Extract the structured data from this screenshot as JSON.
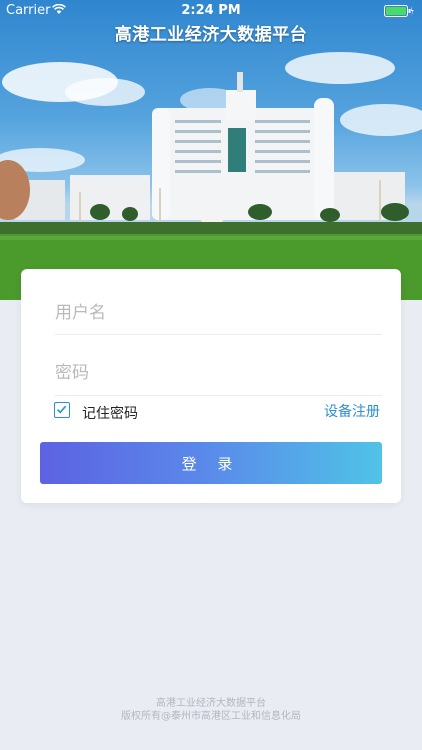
{
  "status_bar": {
    "carrier": "Carrier",
    "time": "2:24 PM",
    "wifi_icon": "wifi-icon",
    "battery_icon": "battery-icon"
  },
  "header": {
    "title": "高港工业经济大数据平台"
  },
  "login_form": {
    "username": {
      "placeholder": "用户名",
      "value": ""
    },
    "password": {
      "placeholder": "密码",
      "value": ""
    },
    "remember": {
      "label": "记住密码",
      "checked": true
    },
    "register_label": "设备注册",
    "login_label": "登 录"
  },
  "footer": {
    "line1": "高港工业经济大数据平台",
    "line2": "版权所有@泰州市高港区工业和信息化局"
  },
  "colors": {
    "accent": "#2d8fd5",
    "button_gradient_start": "#5d62e2",
    "button_gradient_end": "#4fc3e6",
    "page_background": "#e9ecf3"
  }
}
